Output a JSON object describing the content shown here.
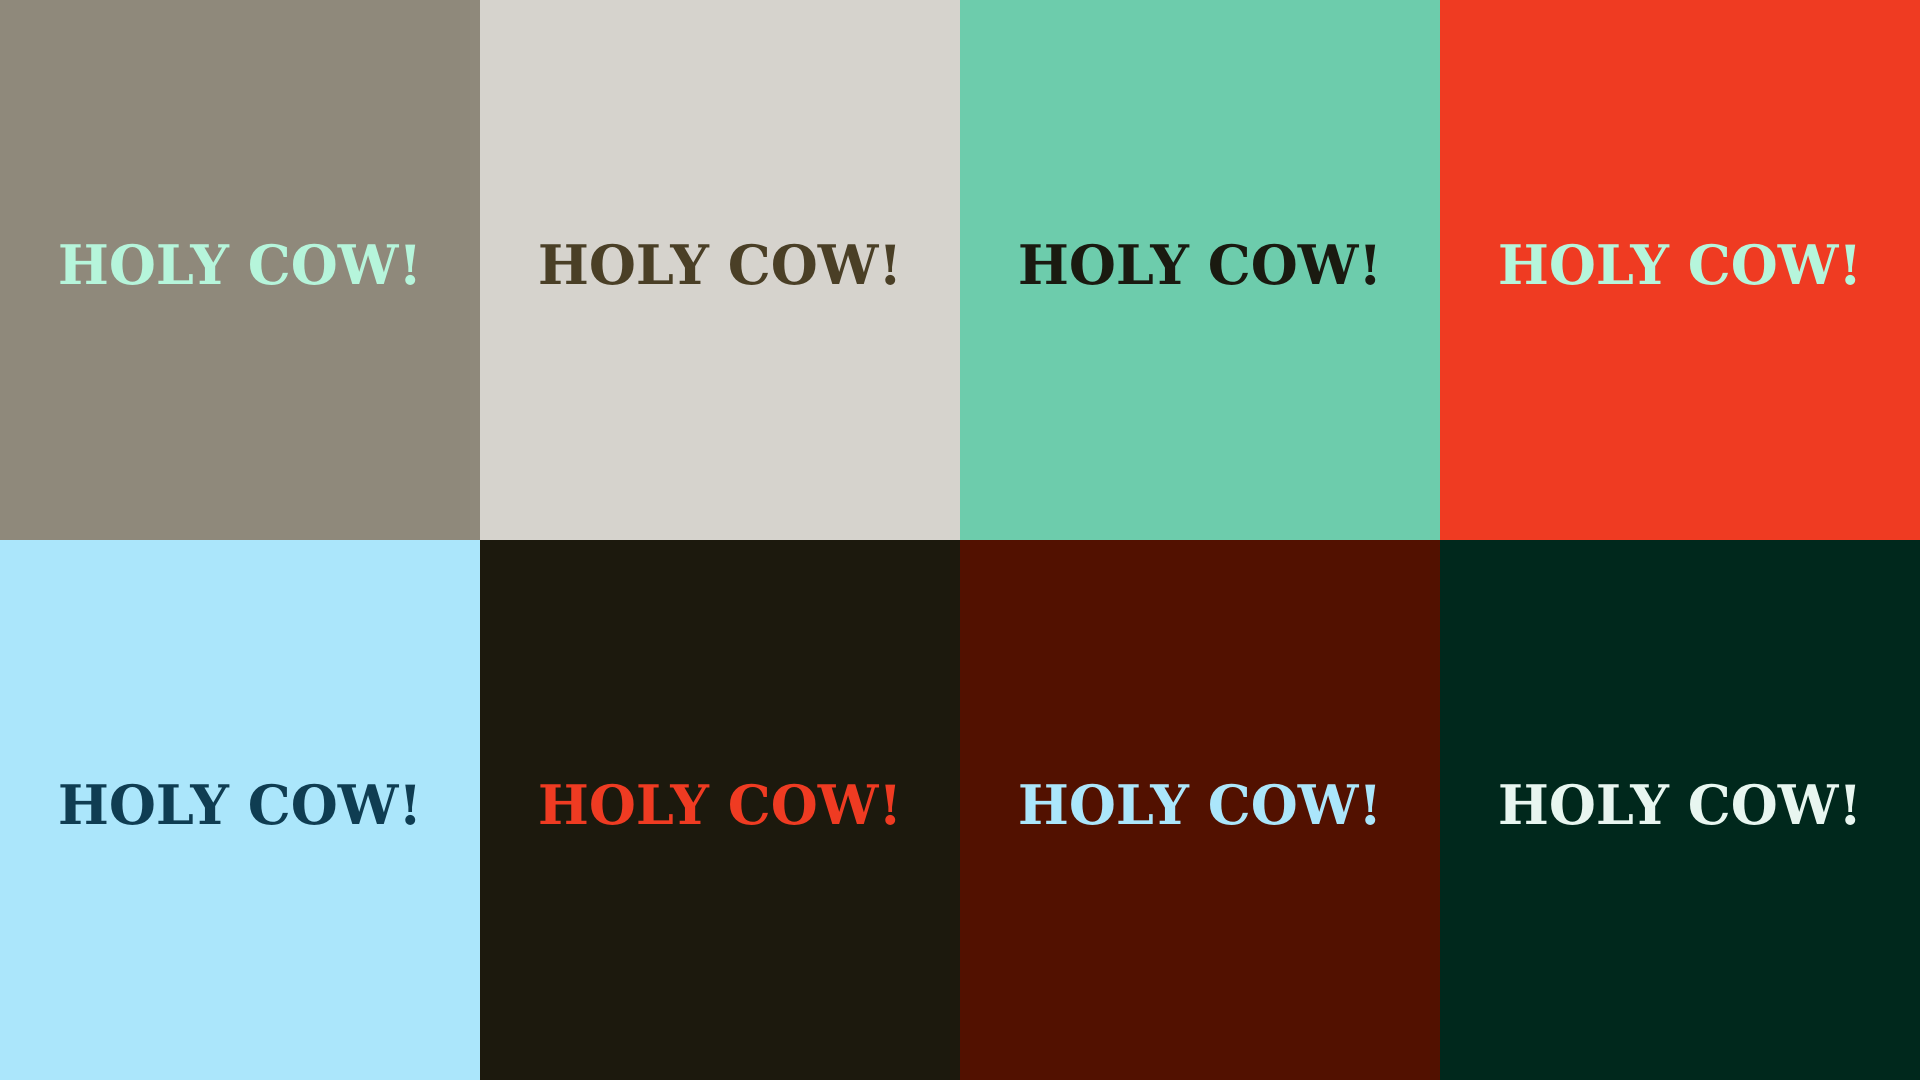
{
  "swatches": [
    {
      "text": "HOLY COW!",
      "background": "#8F897B",
      "color": "#B6F5DB"
    },
    {
      "text": "HOLY COW!",
      "background": "#D6D3CD",
      "color": "#4A3F26"
    },
    {
      "text": "HOLY COW!",
      "background": "#6DCCAC",
      "color": "#1A1A10"
    },
    {
      "text": "HOLY COW!",
      "background": "#EF3B22",
      "color": "#B6F5DB"
    },
    {
      "text": "HOLY COW!",
      "background": "#ABE6FB",
      "color": "#0F3D52"
    },
    {
      "text": "HOLY COW!",
      "background": "#1C190D",
      "color": "#EF3B22"
    },
    {
      "text": "HOLY COW!",
      "background": "#521100",
      "color": "#ABE6FB"
    },
    {
      "text": "HOLY COW!",
      "background": "#00281C",
      "color": "#E8F6F0"
    }
  ]
}
